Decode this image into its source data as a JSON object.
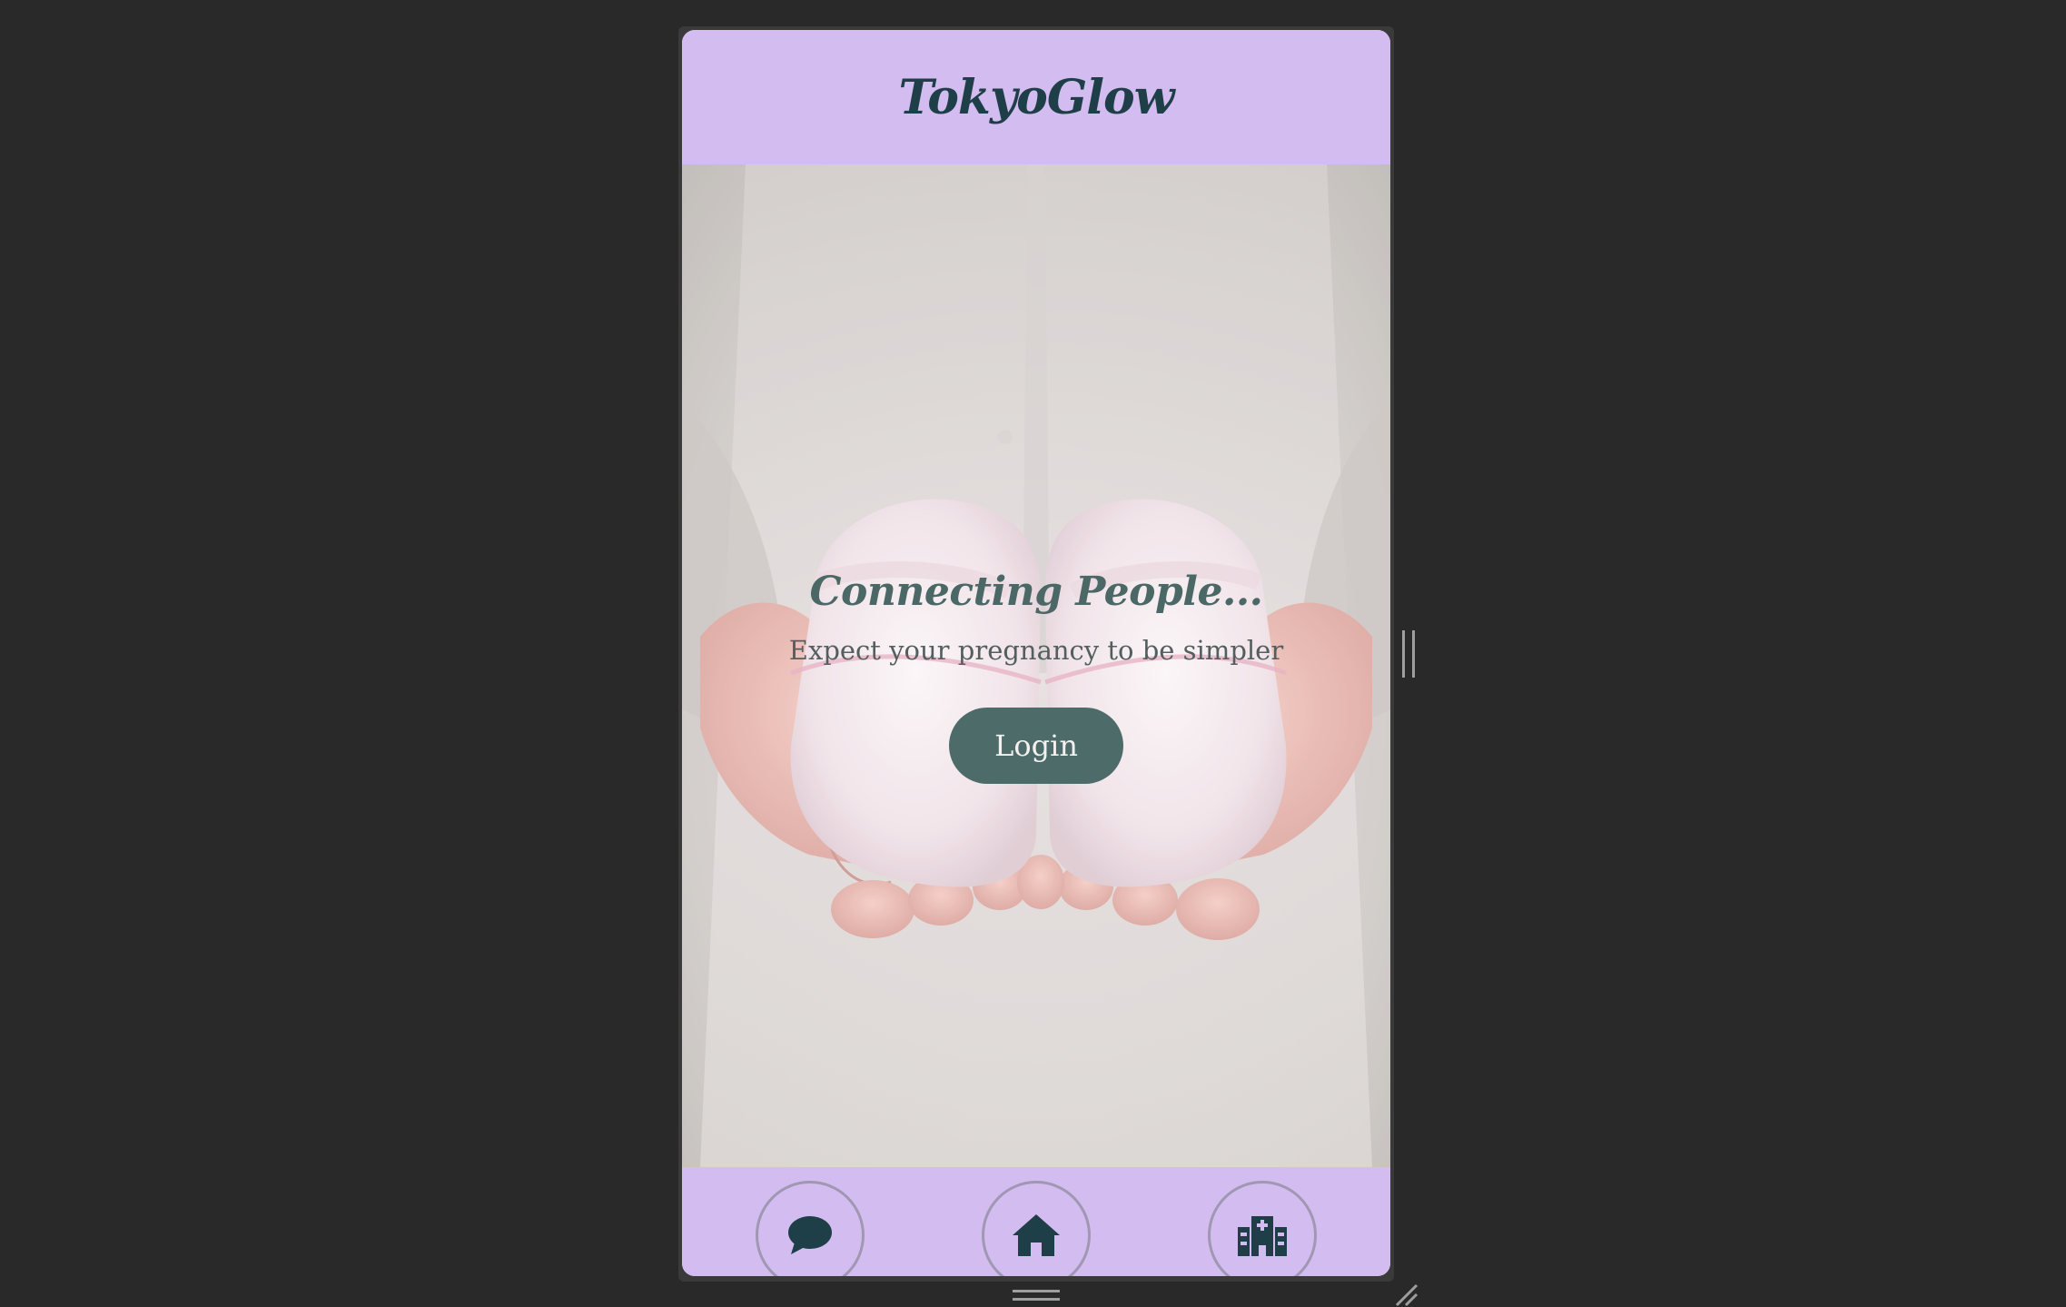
{
  "app": {
    "brand": "TokyoGlow"
  },
  "hero": {
    "tagline": "Connecting People...",
    "subtitle": "Expect your pregnancy to be simpler",
    "login_label": "Login",
    "image": "hands-holding-pink-baby-shoes"
  },
  "bottom_nav": {
    "items": [
      {
        "icon": "chat-bubble-icon"
      },
      {
        "icon": "home-icon"
      },
      {
        "icon": "hospital-icon"
      }
    ]
  },
  "colors": {
    "header_bg": "#d3bcef",
    "brand_text": "#1e3e48",
    "tagline_text": "#4b6866",
    "button_bg": "#4d6b69",
    "icon_fill": "#1e3e48",
    "page_bg": "#292929"
  }
}
